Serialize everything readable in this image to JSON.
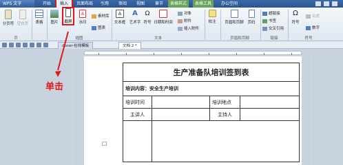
{
  "titlebar": {
    "app_label": "WPS 文字",
    "tabs": [
      "开始",
      "插入",
      "页面布局",
      "引用",
      "审阅",
      "视图",
      "章节",
      "表格样式",
      "表格工具",
      "办公空间"
    ],
    "active_tab": "插入"
  },
  "ribbon": {
    "buttons": {
      "page_break": "分页符",
      "blank_page": "空白页",
      "table": "表格",
      "picture": "图片",
      "screenshot": "截屏",
      "shape": "形状",
      "watermark": "水印",
      "clipart": "素材库",
      "chart": "图表",
      "textbox": "文本框",
      "art_text": "艺术字",
      "symbol_btn": "符号",
      "date": "日期和时间",
      "object": "对象",
      "attachment": "附件",
      "insert_attach": "插入附件",
      "comment": "批注",
      "header_footer": "页眉和页脚",
      "page_num": "页码",
      "hyperlink": "超链接",
      "bookmark": "书签",
      "cross_ref": "交叉引用",
      "symbol": "符号",
      "formula": "公式",
      "number": "数字"
    },
    "groups": {
      "page": "页",
      "illustration": "插图",
      "text": "文本",
      "header_footer_grp": "页眉和页脚",
      "link": "链接",
      "symbol_grp": "符号"
    }
  },
  "doc_tabs": [
    "docer-在线模板",
    "文档 2 *"
  ],
  "annotation": {
    "callout": "单击"
  },
  "document": {
    "title": "生产准备队培训签到表",
    "content_label": "培训内容：安全生产培训",
    "training_time": "培训时间",
    "training_place": "培训地点",
    "lecturer": "主讲人",
    "host": "主持人"
  },
  "colors": {
    "highlight_red": "#e01818",
    "ribbon_blue": "#3b6aa8",
    "context_green": "#6aa35a"
  }
}
